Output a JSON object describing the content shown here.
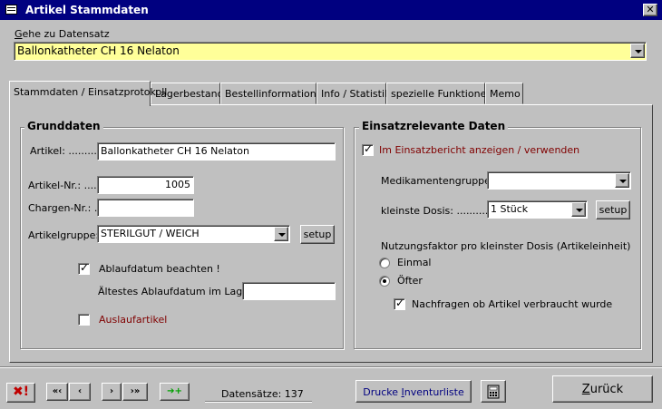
{
  "window": {
    "title": "Artikel Stammdaten",
    "close_symbol": "✕"
  },
  "goto": {
    "label_pre": "G",
    "label_post": "ehe zu Datensatz",
    "value": "Ballonkatheter CH 16 Nelaton"
  },
  "tabs": [
    {
      "label": "Stammdaten / Einsatzprotokoll"
    },
    {
      "label": "Lagerbestand"
    },
    {
      "label": "Bestellinformationen"
    },
    {
      "label": "Info / Statistik"
    },
    {
      "label": "spezielle Funktionen"
    },
    {
      "label": "Memo"
    }
  ],
  "grunddaten": {
    "title": "Grunddaten",
    "artikel_label": "Artikel: ...........",
    "artikel_value": "Ballonkatheter CH 16 Nelaton",
    "artikelnr_label": "Artikel-Nr.: ....",
    "artikelnr_value": "1005",
    "chargennr_label": "Chargen-Nr.: ...",
    "chargennr_value": "",
    "artikelgruppe_label": "Artikelgruppe: .",
    "artikelgruppe_value": "STERILGUT / WEICH",
    "setup_label": "setup",
    "ablaufdatum_label": "Ablaufdatum beachten !",
    "ablaufdatum_checked": true,
    "aeltestes_label": "Ältestes Ablaufdatum im Lager: ..",
    "aeltestes_value": "",
    "auslauf_label": "Auslaufartikel",
    "auslauf_checked": false
  },
  "einsatz": {
    "title": "Einsatzrelevante Daten",
    "bericht_label": "Im Einsatzbericht anzeigen / verwenden",
    "bericht_checked": true,
    "medikamentengruppe_label": "Medikamentengruppe: .",
    "medikamentengruppe_value": "",
    "dosis_label": "kleinste Dosis: .............",
    "dosis_value": "1 Stück",
    "setup_label": "setup",
    "nutzung_label": "Nutzungsfaktor pro kleinster Dosis (Artikeleinheit)",
    "einmal_label": "Einmal",
    "oefter_label": "Öfter",
    "selected": "oefter",
    "nachfragen_label": "Nachfragen ob Artikel verbraucht wurde",
    "nachfragen_checked": true
  },
  "footer": {
    "datensaetze_label": "Datensätze: 137",
    "drucke_pre": "Drucke ",
    "drucke_u": "I",
    "drucke_post": "nventurliste",
    "zurueck_pre": "Z",
    "zurueck_post": "urück",
    "nav": {
      "first": "«‹",
      "prev": "‹",
      "next": "›",
      "last": "›»",
      "new": "➔+"
    }
  },
  "colors": {
    "titlebar": "#000080",
    "goto_bg": "#ffff99",
    "red_label": "#800000",
    "new_plus": "#00a000",
    "delete_x": "#c00000"
  }
}
